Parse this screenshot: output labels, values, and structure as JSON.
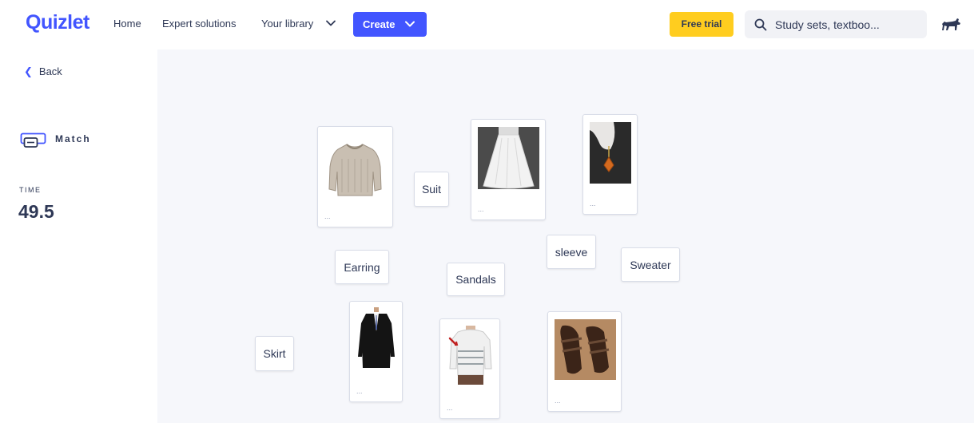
{
  "header": {
    "logo": "Quizlet",
    "nav": {
      "home": "Home",
      "expert": "Expert solutions",
      "library": "Your library"
    },
    "create_label": "Create",
    "free_trial_label": "Free trial",
    "search_placeholder": "Study sets, textboo..."
  },
  "sidebar": {
    "back_label": "Back",
    "mode_label": "Match",
    "time_label": "TIME",
    "time_value": "49.5"
  },
  "board": {
    "term_cards": [
      "Suit",
      "Earring",
      "Sandals",
      "sleeve",
      "Sweater",
      "Skirt"
    ],
    "image_cards": [
      {
        "icon": "sweater-image",
        "caption": "..."
      },
      {
        "icon": "skirt-image",
        "caption": "..."
      },
      {
        "icon": "earring-image",
        "caption": "..."
      },
      {
        "icon": "suit-image",
        "caption": "..."
      },
      {
        "icon": "sleeve-image",
        "caption": "..."
      },
      {
        "icon": "sandals-image",
        "caption": "..."
      }
    ]
  },
  "colors": {
    "brand": "#4255ff",
    "trial": "#ffcd1f",
    "text": "#2e3856",
    "background": "#f6f7fb"
  }
}
